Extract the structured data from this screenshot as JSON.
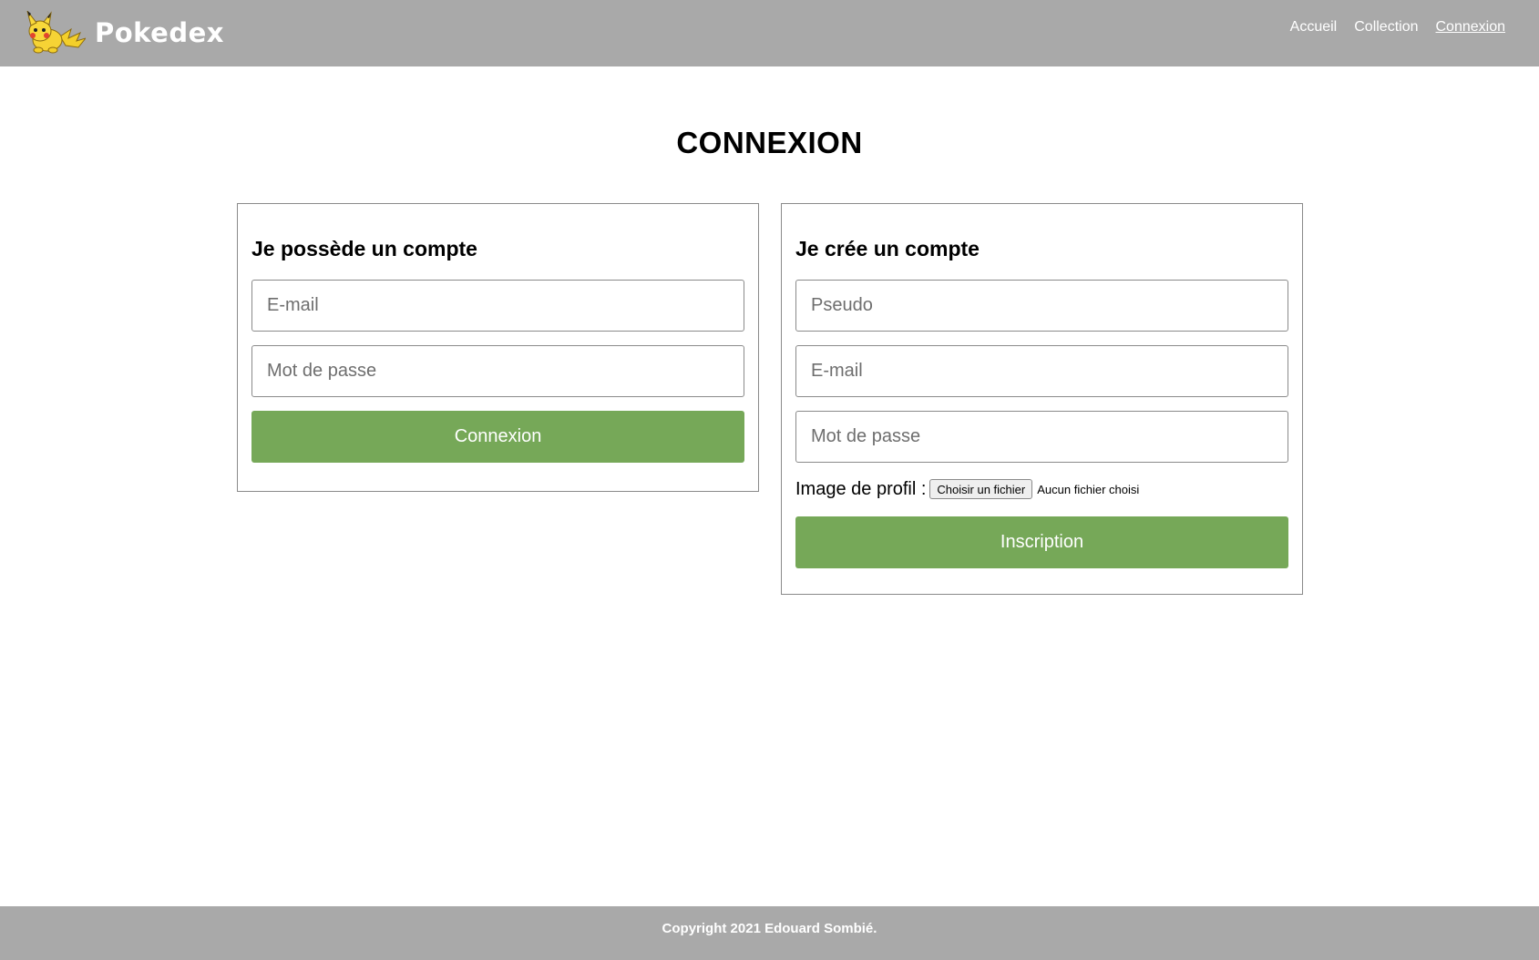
{
  "header": {
    "brand": "Pokedex",
    "logo_icon": "pikachu-icon",
    "nav": [
      {
        "label": "Accueil",
        "active": false
      },
      {
        "label": "Collection",
        "active": false
      },
      {
        "label": "Connexion",
        "active": true
      }
    ]
  },
  "page": {
    "title": "CONNEXION"
  },
  "login": {
    "heading": "Je possède un compte",
    "email_placeholder": "E-mail",
    "password_placeholder": "Mot de passe",
    "submit_label": "Connexion"
  },
  "signup": {
    "heading": "Je crée un compte",
    "pseudo_placeholder": "Pseudo",
    "email_placeholder": "E-mail",
    "password_placeholder": "Mot de passe",
    "image_label": "Image de profil :",
    "file_button_label": "Choisir un fichier",
    "file_status": "Aucun fichier choisi",
    "submit_label": "Inscription"
  },
  "footer": {
    "copyright": "Copyright 2021 Edouard Sombié."
  },
  "colors": {
    "header_bg": "#a9a9a9",
    "button_green": "#76a858",
    "border": "#8a8a8a"
  }
}
